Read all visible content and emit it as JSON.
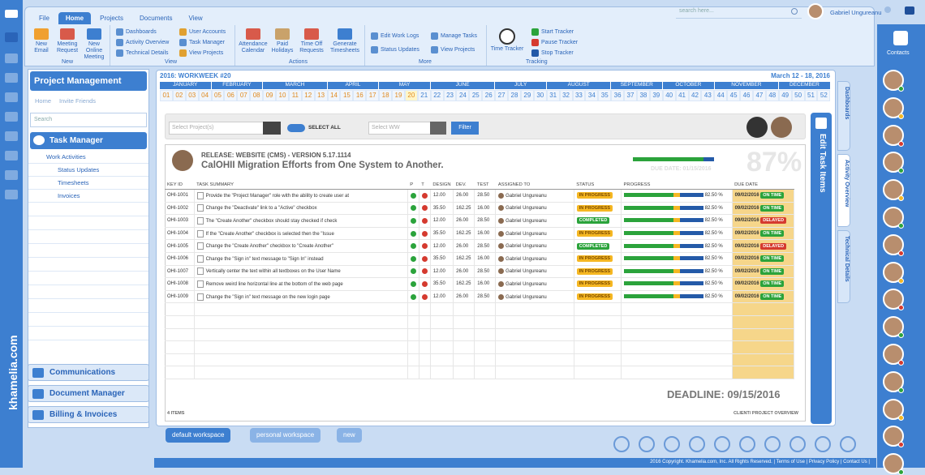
{
  "ribbon": {
    "tabs": [
      "File",
      "Home",
      "Projects",
      "Documents",
      "View"
    ],
    "active_tab": "Home",
    "new_group": {
      "label": "New",
      "buttons": [
        "New Email",
        "Meeting Request",
        "New Online Meeting"
      ]
    },
    "view_group": {
      "label": "View",
      "items": [
        "Dashboards",
        "Activity Overview",
        "Technical Details",
        "User Accounts",
        "Task Manager",
        "View Projects"
      ]
    },
    "actions_group": {
      "label": "Actions",
      "buttons": [
        "Attendance Calendar",
        "Paid Holidays",
        "Time Off Requests",
        "Generate Timesheets"
      ]
    },
    "more_group": {
      "label": "More",
      "items": [
        "Edit Work Logs",
        "Status Updates",
        "Manage Tasks",
        "View Projects"
      ]
    },
    "tracking_group": {
      "label": "Tracking",
      "button": "Time Tracker",
      "items": [
        "Start Tracker",
        "Pause Tracker",
        "Stop Tracker"
      ]
    }
  },
  "topbar": {
    "search_placeholder": "search here...",
    "user_name": "Gabriel Ungureanu"
  },
  "left_panel": {
    "title": "Project Management",
    "nav": [
      "Home",
      "Invite Friends"
    ],
    "search_placeholder": "Search",
    "task_manager": "Task Manager",
    "sub_items": [
      "Work Activities",
      "Status Updates",
      "Timesheets",
      "Invoices"
    ],
    "accordions": [
      "Communications",
      "Document Manager",
      "Billing & Invoices"
    ],
    "brand": "khamelia.com"
  },
  "main": {
    "week_title": "2016: WORKWEEK #20",
    "date_range": "March 12 - 18, 2016",
    "months": [
      "JANUARY",
      "FEBRUARY",
      "MARCH",
      "APRIL",
      "MAY",
      "JUNE",
      "JULY",
      "AUGUST",
      "SEPTEMBER",
      "OCTOBER",
      "NOVEMBER",
      "DECEMBER"
    ],
    "weeks": [
      "01",
      "02",
      "03",
      "04",
      "05",
      "06",
      "07",
      "08",
      "09",
      "10",
      "11",
      "12",
      "13",
      "14",
      "15",
      "16",
      "17",
      "18",
      "19",
      "20",
      "21",
      "22",
      "23",
      "24",
      "25",
      "26",
      "27",
      "28",
      "29",
      "30",
      "31",
      "32",
      "33",
      "34",
      "35",
      "36",
      "37",
      "38",
      "39",
      "40",
      "41",
      "42",
      "43",
      "44",
      "45",
      "46",
      "47",
      "48",
      "49",
      "50",
      "51",
      "52"
    ],
    "filter": {
      "project_placeholder": "Select Project(s)",
      "select_all": "SELECT ALL",
      "ww_placeholder": "Select WW",
      "button": "Filter"
    },
    "release": "RELEASE: WEBSITE (CMS) - VERSION 5.17.1114",
    "release_title": "CalOHII Migration Efforts from One System to Another.",
    "due_date": "DUE DATE: 01/15/2016",
    "percent": "87%",
    "columns": [
      "KEY ID",
      "TASK SUMMARY",
      "P",
      "T",
      "DESIGN",
      "DEV.",
      "TEST",
      "ASSIGNED TO",
      "STATUS",
      "PROGRESS",
      "DUE DATE"
    ],
    "rows": [
      {
        "id": "OHI-1001",
        "summary": "Provide the \"Project Manager\" role with the ability to create user at",
        "design": "12.00",
        "dev": "26.00",
        "test": "28.50",
        "assigned": "Gabriel Ungureanu",
        "status": "IN PROGRESS",
        "progress": "82.50 %",
        "due": "09/02/2016",
        "due_status": "ON TIME"
      },
      {
        "id": "OHI-1002",
        "summary": "Change the \"Deactivate\" link to a \"Active\" checkbox",
        "design": "35.50",
        "dev": "162.25",
        "test": "16.00",
        "assigned": "Gabriel Ungureanu",
        "status": "IN PROGRESS",
        "progress": "82.50 %",
        "due": "09/02/2016",
        "due_status": "ON TIME"
      },
      {
        "id": "OHI-1003",
        "summary": "The \"Create Another\" checkbox should stay checked if check",
        "design": "12.00",
        "dev": "26.00",
        "test": "28.50",
        "assigned": "Gabriel Ungureanu",
        "status": "COMPLETED",
        "progress": "82.50 %",
        "due": "09/02/2016",
        "due_status": "DELAYED"
      },
      {
        "id": "OHI-1004",
        "summary": "If the \"Create Another\" checkbox is selected then the \"Issue",
        "design": "35.50",
        "dev": "162.25",
        "test": "16.00",
        "assigned": "Gabriel Ungureanu",
        "status": "IN PROGRESS",
        "progress": "82.50 %",
        "due": "09/02/2016",
        "due_status": "ON TIME"
      },
      {
        "id": "OHI-1005",
        "summary": "Change the \"Create Another\" checkbox to \"Create Another\"",
        "design": "12.00",
        "dev": "26.00",
        "test": "28.50",
        "assigned": "Gabriel Ungureanu",
        "status": "COMPLETED",
        "progress": "82.50 %",
        "due": "09/02/2016",
        "due_status": "DELAYED"
      },
      {
        "id": "OHI-1006",
        "summary": "Change the \"Sign in\" text message to \"Sign In\" instead",
        "design": "35.50",
        "dev": "162.25",
        "test": "16.00",
        "assigned": "Gabriel Ungureanu",
        "status": "IN PROGRESS",
        "progress": "82.50 %",
        "due": "09/02/2016",
        "due_status": "ON TIME"
      },
      {
        "id": "OHI-1007",
        "summary": "Vertically center the text within all textboxes on the User Name",
        "design": "12.00",
        "dev": "26.00",
        "test": "28.50",
        "assigned": "Gabriel Ungureanu",
        "status": "IN PROGRESS",
        "progress": "82.50 %",
        "due": "09/02/2016",
        "due_status": "ON TIME"
      },
      {
        "id": "OHI-1008",
        "summary": "Remove weird line horizontal line at the bottom of the web page",
        "design": "35.50",
        "dev": "162.25",
        "test": "16.00",
        "assigned": "Gabriel Ungureanu",
        "status": "IN PROGRESS",
        "progress": "82.50 %",
        "due": "09/02/2016",
        "due_status": "ON TIME"
      },
      {
        "id": "OHI-1009",
        "summary": "Change the \"Sign in\" text message on the new login page",
        "design": "12.00",
        "dev": "26.00",
        "test": "28.50",
        "assigned": "Gabriel Ungureanu",
        "status": "IN PROGRESS",
        "progress": "82.50 %",
        "due": "09/02/2016",
        "due_status": "ON TIME"
      }
    ],
    "deadline": "DEADLINE: 09/15/2016",
    "items_count": "4 ITEMS",
    "client_overview": "CLIENT/ PROJECT OVERVIEW",
    "edit_tab": "Edit Task Items",
    "side_tabs": [
      "Dashboards",
      "Activity Overview",
      "Technical Details"
    ]
  },
  "workspace_tabs": [
    "default workspace",
    "personal workspace",
    "new"
  ],
  "contacts_label": "Contacts",
  "footer": "2016 Copyright. Khamelia.com, Inc. All Rights Reserved. | Terms of Use | Privacy Policy | Contact Us |",
  "colors": {
    "accent": "#3d7fd0",
    "in_progress": "#f5b722",
    "completed": "#2ba33b",
    "delayed": "#d53a2f",
    "due_column": "#f6d68a"
  }
}
